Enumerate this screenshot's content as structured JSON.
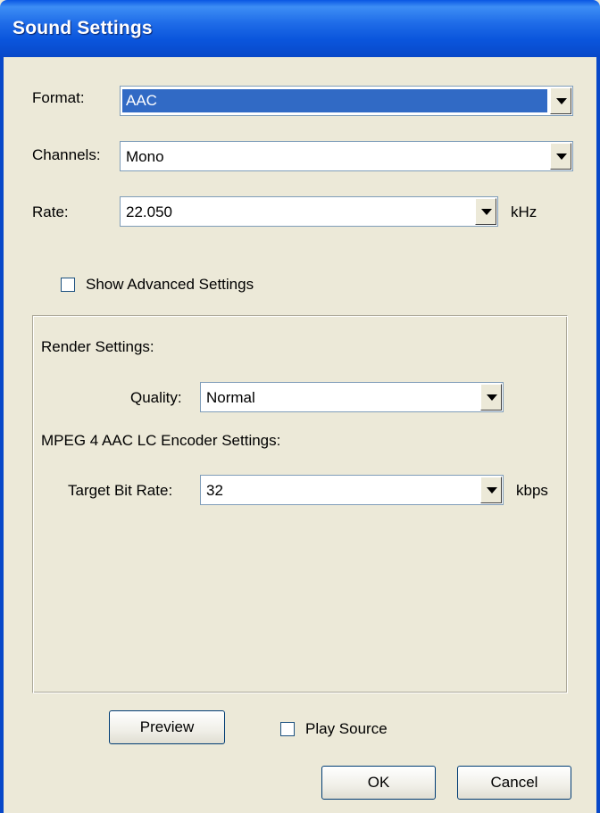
{
  "window": {
    "title": "Sound Settings"
  },
  "format": {
    "label": "Format:",
    "value": "AAC"
  },
  "channels": {
    "label": "Channels:",
    "value": "Mono"
  },
  "rate": {
    "label": "Rate:",
    "value": "22.050",
    "unit": "kHz"
  },
  "advanced": {
    "label": "Show Advanced Settings",
    "checked": false
  },
  "render": {
    "heading": "Render Settings:",
    "quality_label": "Quality:",
    "quality_value": "Normal"
  },
  "encoder": {
    "heading": "MPEG 4 AAC LC Encoder Settings:",
    "bitrate_label": "Target Bit Rate:",
    "bitrate_value": "32",
    "unit": "kbps"
  },
  "footer": {
    "preview": "Preview",
    "play_source": "Play Source",
    "play_source_checked": false,
    "ok": "OK",
    "cancel": "Cancel"
  }
}
